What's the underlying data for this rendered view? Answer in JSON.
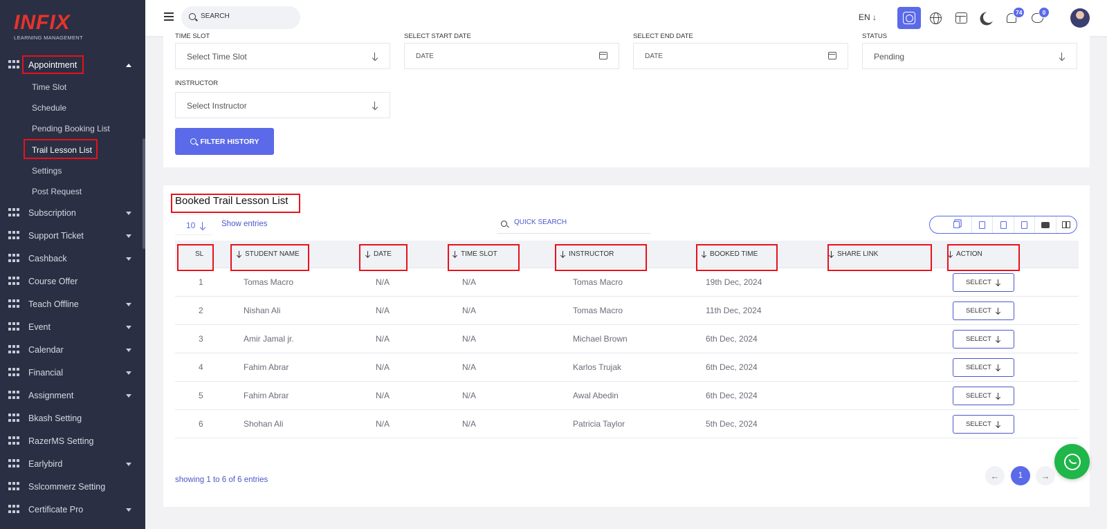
{
  "logo": {
    "main": "INFIX",
    "sub": "LEARNING MANAGEMENT"
  },
  "sidebar": {
    "open_section": "Appointment",
    "sub_items": [
      "Time Slot",
      "Schedule",
      "Pending Booking List",
      "Trail Lesson List",
      "Settings",
      "Post Request"
    ],
    "active_sub_item": "Trail Lesson List",
    "items": [
      "Subscription",
      "Support Ticket",
      "Cashback",
      "Course Offer",
      "Teach Offline",
      "Event",
      "Calendar",
      "Financial",
      "Assignment",
      "Bkash Setting",
      "RazerMS Setting",
      "Earlybird",
      "Sslcommerz Setting",
      "Certificate Pro"
    ]
  },
  "header": {
    "search_placeholder": "SEARCH",
    "language": "EN",
    "notification_count": "74",
    "message_count": "0"
  },
  "filters": {
    "time_slot_label": "TIME SLOT",
    "time_slot_value": "Select Time Slot",
    "start_date_label": "SELECT START DATE",
    "start_date_placeholder": "DATE",
    "end_date_label": "SELECT END DATE",
    "end_date_placeholder": "DATE",
    "status_label": "STATUS",
    "status_value": "Pending",
    "instructor_label": "INSTRUCTOR",
    "instructor_value": "Select Instructor",
    "filter_button": "FILTER HISTORY"
  },
  "list": {
    "title": "Booked Trail Lesson List",
    "entries_value": "10",
    "show_entries": "Show entries",
    "quick_search_placeholder": "QUICK SEARCH",
    "columns": [
      "SL",
      "STUDENT NAME",
      "DATE",
      "TIME SLOT",
      "INSTRUCTOR",
      "BOOKED TIME",
      "SHARE LINK",
      "ACTION"
    ],
    "rows": [
      {
        "sl": "1",
        "student": "Tomas Macro",
        "date": "N/A",
        "slot": "N/A",
        "instructor": "Tomas Macro",
        "booked": "19th Dec, 2024",
        "action": "SELECT"
      },
      {
        "sl": "2",
        "student": "Nishan Ali",
        "date": "N/A",
        "slot": "N/A",
        "instructor": "Tomas Macro",
        "booked": "11th Dec, 2024",
        "action": "SELECT"
      },
      {
        "sl": "3",
        "student": "Amir Jamal jr.",
        "date": "N/A",
        "slot": "N/A",
        "instructor": "Michael Brown",
        "booked": "6th Dec, 2024",
        "action": "SELECT"
      },
      {
        "sl": "4",
        "student": "Fahim Abrar",
        "date": "N/A",
        "slot": "N/A",
        "instructor": "Karlos Trujak",
        "booked": "6th Dec, 2024",
        "action": "SELECT"
      },
      {
        "sl": "5",
        "student": "Fahim Abrar",
        "date": "N/A",
        "slot": "N/A",
        "instructor": "Awal Abedin",
        "booked": "6th Dec, 2024",
        "action": "SELECT"
      },
      {
        "sl": "6",
        "student": "Shohan Ali",
        "date": "N/A",
        "slot": "N/A",
        "instructor": "Patricia Taylor",
        "booked": "5th Dec, 2024",
        "action": "SELECT"
      }
    ],
    "showing": "showing 1 to 6 of 6 entries",
    "current_page": "1"
  },
  "colors": {
    "accent": "#5a6ae8",
    "sidebar_bg": "#2b2f43",
    "highlight": "#e8111b",
    "whatsapp": "#1fb64a"
  }
}
